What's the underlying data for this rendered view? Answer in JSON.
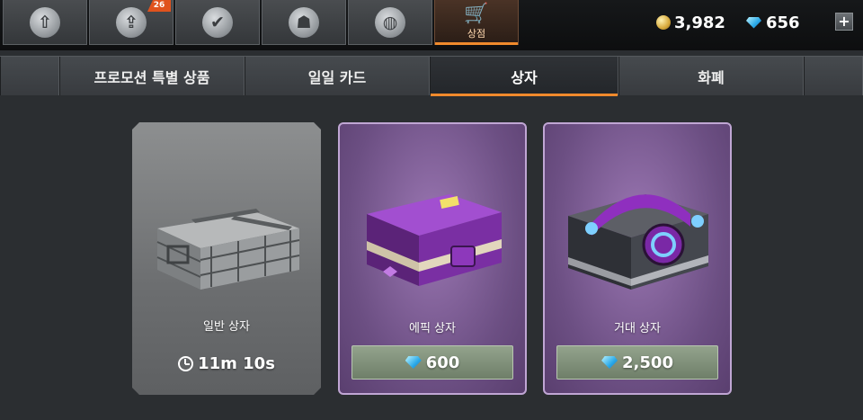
{
  "topbar": {
    "nav": [
      {
        "name": "nav-garage",
        "icon": "rocket-icon",
        "glyph": "⇧"
      },
      {
        "name": "nav-upgrade",
        "icon": "upgrade-arrow-icon",
        "glyph": "⇪",
        "badge": "26"
      },
      {
        "name": "nav-missions",
        "icon": "checkmark-wreath-icon",
        "glyph": "✔"
      },
      {
        "name": "nav-clan",
        "icon": "group-shield-icon",
        "glyph": "☗"
      },
      {
        "name": "nav-world",
        "icon": "globe-icon",
        "glyph": "◍"
      },
      {
        "name": "nav-shop",
        "icon": "cart-icon",
        "glyph": "🛒",
        "label": "상점",
        "active": true
      }
    ],
    "coins": "3,982",
    "gems": "656",
    "add_label": "+"
  },
  "tabs": [
    {
      "label": "프로모션 특별 상품"
    },
    {
      "label": "일일 카드"
    },
    {
      "label": "상자",
      "active": true
    },
    {
      "label": "화폐"
    }
  ],
  "cards": [
    {
      "name": "일반 상자",
      "timer": "11m 10s",
      "style": "basic"
    },
    {
      "name": "에픽 상자",
      "price": "600",
      "style": "epic"
    },
    {
      "name": "거대 상자",
      "price": "2,500",
      "style": "epic"
    }
  ],
  "colors": {
    "accent": "#f08a2c",
    "epic_purple": "#7a5a92",
    "price_green": "#7f8f79"
  }
}
